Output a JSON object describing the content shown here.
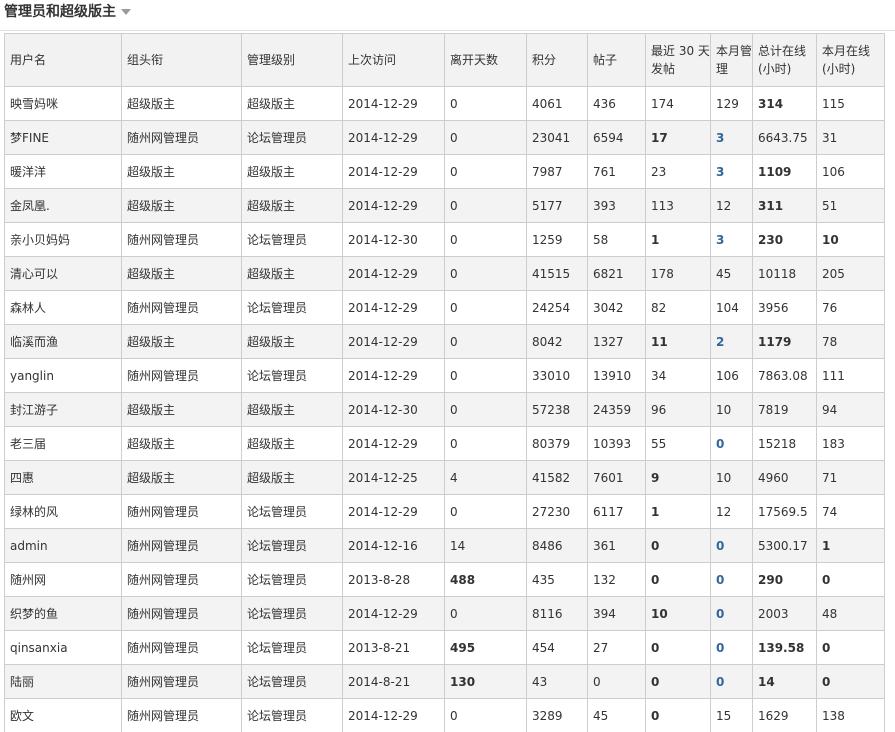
{
  "section": {
    "title": "管理员和超级版主"
  },
  "colors": {
    "moderator": "#ff6600",
    "admin_group": "#cc0000",
    "link": "#336699"
  },
  "headers": [
    "用户名",
    "组头衔",
    "管理级别",
    "上次访问",
    "离开天数",
    "积分",
    "帖子",
    "最近 30 天发帖",
    "本月管理",
    "总计在线 (小时)",
    "本月在线 (小时)"
  ],
  "rows": [
    {
      "user": "映雪妈咪",
      "group": "超级版主",
      "group_type": "moderator",
      "level": "超级版主",
      "last_visit": "2014-12-29",
      "days_away": "0",
      "credits": "4061",
      "posts": "436",
      "posts_30d": "174",
      "manage_month": "129",
      "total_online": "314",
      "month_online": "115",
      "bold": [
        "total_online"
      ]
    },
    {
      "user": "梦FINE",
      "group": "随州网管理员",
      "group_type": "admin",
      "level": "论坛管理员",
      "last_visit": "2014-12-29",
      "days_away": "0",
      "credits": "23041",
      "posts": "6594",
      "posts_30d": "17",
      "manage_month": "3",
      "total_online": "6643.75",
      "month_online": "31",
      "bold": [
        "posts_30d",
        "manage_month"
      ]
    },
    {
      "user": "暖洋洋",
      "group": "超级版主",
      "group_type": "moderator",
      "level": "超级版主",
      "last_visit": "2014-12-29",
      "days_away": "0",
      "credits": "7987",
      "posts": "761",
      "posts_30d": "23",
      "manage_month": "3",
      "total_online": "1109",
      "month_online": "106",
      "bold": [
        "manage_month",
        "total_online"
      ]
    },
    {
      "user": "金凤凰.",
      "group": "超级版主",
      "group_type": "moderator",
      "level": "超级版主",
      "last_visit": "2014-12-29",
      "days_away": "0",
      "credits": "5177",
      "posts": "393",
      "posts_30d": "113",
      "manage_month": "12",
      "total_online": "311",
      "month_online": "51",
      "bold": [
        "total_online"
      ]
    },
    {
      "user": "亲小贝妈妈",
      "group": "随州网管理员",
      "group_type": "admin",
      "level": "论坛管理员",
      "last_visit": "2014-12-30",
      "days_away": "0",
      "credits": "1259",
      "posts": "58",
      "posts_30d": "1",
      "manage_month": "3",
      "total_online": "230",
      "month_online": "10",
      "bold": [
        "posts_30d",
        "manage_month",
        "total_online",
        "month_online"
      ]
    },
    {
      "user": "清心可以",
      "group": "超级版主",
      "group_type": "moderator",
      "level": "超级版主",
      "last_visit": "2014-12-29",
      "days_away": "0",
      "credits": "41515",
      "posts": "6821",
      "posts_30d": "178",
      "manage_month": "45",
      "total_online": "10118",
      "month_online": "205",
      "bold": []
    },
    {
      "user": "森林人",
      "group": "随州网管理员",
      "group_type": "admin",
      "level": "论坛管理员",
      "last_visit": "2014-12-29",
      "days_away": "0",
      "credits": "24254",
      "posts": "3042",
      "posts_30d": "82",
      "manage_month": "104",
      "total_online": "3956",
      "month_online": "76",
      "bold": []
    },
    {
      "user": "临溪而渔",
      "group": "超级版主",
      "group_type": "moderator",
      "level": "超级版主",
      "last_visit": "2014-12-29",
      "days_away": "0",
      "credits": "8042",
      "posts": "1327",
      "posts_30d": "11",
      "manage_month": "2",
      "total_online": "1179",
      "month_online": "78",
      "bold": [
        "posts_30d",
        "manage_month",
        "total_online"
      ]
    },
    {
      "user": "yanglin",
      "group": "随州网管理员",
      "group_type": "admin",
      "level": "论坛管理员",
      "last_visit": "2014-12-29",
      "days_away": "0",
      "credits": "33010",
      "posts": "13910",
      "posts_30d": "34",
      "manage_month": "106",
      "total_online": "7863.08",
      "month_online": "111",
      "bold": []
    },
    {
      "user": "封江游子",
      "group": "超级版主",
      "group_type": "moderator",
      "level": "超级版主",
      "last_visit": "2014-12-30",
      "days_away": "0",
      "credits": "57238",
      "posts": "24359",
      "posts_30d": "96",
      "manage_month": "10",
      "total_online": "7819",
      "month_online": "94",
      "bold": []
    },
    {
      "user": "老三届",
      "group": "超级版主",
      "group_type": "moderator",
      "level": "超级版主",
      "last_visit": "2014-12-29",
      "days_away": "0",
      "credits": "80379",
      "posts": "10393",
      "posts_30d": "55",
      "manage_month": "0",
      "total_online": "15218",
      "month_online": "183",
      "bold": [
        "manage_month"
      ]
    },
    {
      "user": "四惠",
      "group": "超级版主",
      "group_type": "moderator",
      "level": "超级版主",
      "last_visit": "2014-12-25",
      "days_away": "4",
      "credits": "41582",
      "posts": "7601",
      "posts_30d": "9",
      "manage_month": "10",
      "total_online": "4960",
      "month_online": "71",
      "bold": [
        "posts_30d"
      ]
    },
    {
      "user": "绿林的风",
      "group": "随州网管理员",
      "group_type": "admin",
      "level": "论坛管理员",
      "last_visit": "2014-12-29",
      "days_away": "0",
      "credits": "27230",
      "posts": "6117",
      "posts_30d": "1",
      "manage_month": "12",
      "total_online": "17569.5",
      "month_online": "74",
      "bold": [
        "posts_30d"
      ]
    },
    {
      "user": "admin",
      "group": "随州网管理员",
      "group_type": "admin",
      "level": "论坛管理员",
      "last_visit": "2014-12-16",
      "days_away": "14",
      "credits": "8486",
      "posts": "361",
      "posts_30d": "0",
      "manage_month": "0",
      "total_online": "5300.17",
      "month_online": "1",
      "bold": [
        "posts_30d",
        "manage_month",
        "month_online"
      ]
    },
    {
      "user": "随州网",
      "group": "随州网管理员",
      "group_type": "admin",
      "level": "论坛管理员",
      "last_visit": "2013-8-28",
      "days_away": "488",
      "credits": "435",
      "posts": "132",
      "posts_30d": "0",
      "manage_month": "0",
      "total_online": "290",
      "month_online": "0",
      "bold": [
        "days_away",
        "posts_30d",
        "manage_month",
        "total_online",
        "month_online"
      ]
    },
    {
      "user": "织梦的鱼",
      "group": "随州网管理员",
      "group_type": "admin",
      "level": "论坛管理员",
      "last_visit": "2014-12-29",
      "days_away": "0",
      "credits": "8116",
      "posts": "394",
      "posts_30d": "10",
      "manage_month": "0",
      "total_online": "2003",
      "month_online": "48",
      "bold": [
        "posts_30d",
        "manage_month"
      ]
    },
    {
      "user": "qinsanxia",
      "group": "随州网管理员",
      "group_type": "admin",
      "level": "论坛管理员",
      "last_visit": "2013-8-21",
      "days_away": "495",
      "credits": "454",
      "posts": "27",
      "posts_30d": "0",
      "manage_month": "0",
      "total_online": "139.58",
      "month_online": "0",
      "bold": [
        "days_away",
        "posts_30d",
        "manage_month",
        "total_online",
        "month_online"
      ]
    },
    {
      "user": "陆丽",
      "group": "随州网管理员",
      "group_type": "admin",
      "level": "论坛管理员",
      "last_visit": "2014-8-21",
      "days_away": "130",
      "credits": "43",
      "posts": "0",
      "posts_30d": "0",
      "manage_month": "0",
      "total_online": "14",
      "month_online": "0",
      "bold": [
        "days_away",
        "posts_30d",
        "manage_month",
        "total_online",
        "month_online"
      ]
    },
    {
      "user": "欧文",
      "group": "随州网管理员",
      "group_type": "admin",
      "level": "论坛管理员",
      "last_visit": "2014-12-29",
      "days_away": "0",
      "credits": "3289",
      "posts": "45",
      "posts_30d": "0",
      "manage_month": "15",
      "total_online": "1629",
      "month_online": "138",
      "bold": [
        "posts_30d"
      ]
    }
  ]
}
